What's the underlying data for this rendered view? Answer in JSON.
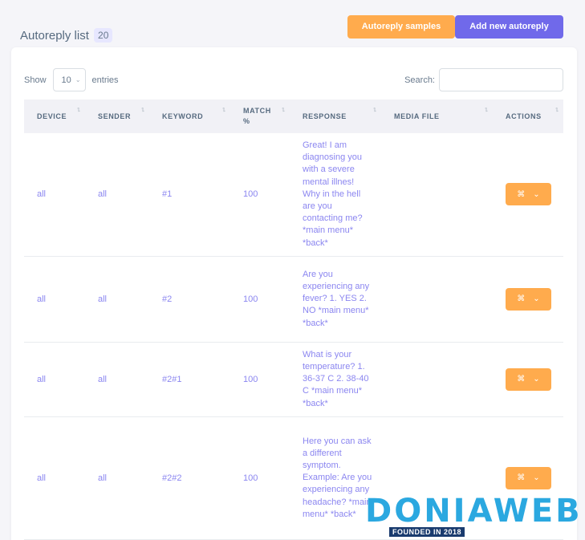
{
  "header": {
    "title": "Autoreply list",
    "count": "20",
    "samples_label": "Autoreply samples",
    "add_label": "Add new autoreply"
  },
  "controls": {
    "show_label": "Show",
    "entries_value": "10",
    "entries_label": "entries",
    "search_label": "Search:",
    "search_placeholder": ""
  },
  "table": {
    "columns": [
      "DEVICE",
      "SENDER",
      "KEYWORD",
      "MATCH %",
      "RESPONSE",
      "MEDIA FILE",
      "ACTIONS"
    ],
    "action_icon": "⌘",
    "rows": [
      {
        "device": "all",
        "sender": "all",
        "keyword": "#1",
        "match": "100",
        "response": "Great! I am diagnosing you with a severe mental illnes! Why in the hell are you contacting me? *main menu* *back*",
        "media": ""
      },
      {
        "device": "all",
        "sender": "all",
        "keyword": "#2",
        "match": "100",
        "response": "Are you experiencing any fever? 1. YES 2. NO *main menu* *back*",
        "media": ""
      },
      {
        "device": "all",
        "sender": "all",
        "keyword": "#2#1",
        "match": "100",
        "response": "What is your temperature? 1. 36-37 C 2. 38-40 C *main menu* *back*",
        "media": ""
      },
      {
        "device": "all",
        "sender": "all",
        "keyword": "#2#2",
        "match": "100",
        "response": "Here you can ask a different symptom. Example: Are you experiencing any headache? *main menu* *back*",
        "media": ""
      }
    ]
  },
  "watermark": {
    "brand": "DONIAWEB",
    "tagline": "FOUNDED IN 2018"
  },
  "colors": {
    "accent_orange": "#ffab4d",
    "accent_purple": "#7069ea",
    "link_text": "#8b86f0"
  }
}
